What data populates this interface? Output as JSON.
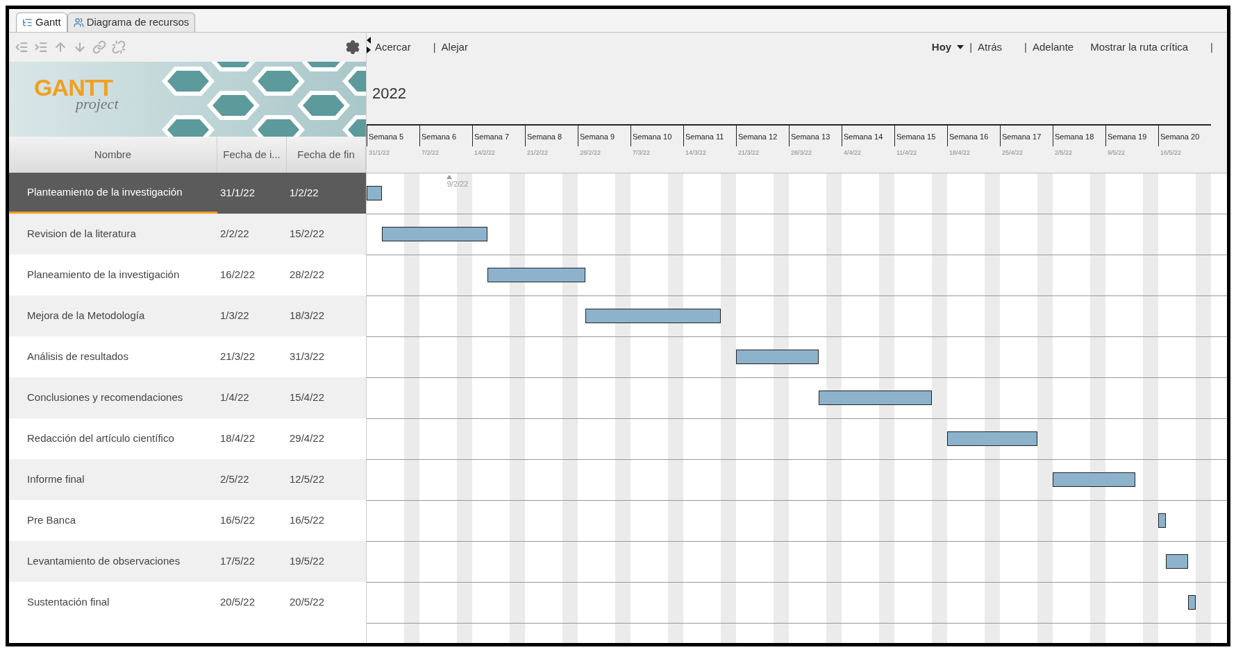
{
  "tabs": [
    {
      "label": "Gantt",
      "kind": "gantt",
      "selected": true
    },
    {
      "label": "Diagrama de recursos",
      "kind": "resources",
      "selected": false
    }
  ],
  "task_toolbar": {
    "tools": [
      {
        "kind": "outdent",
        "disabled": true
      },
      {
        "kind": "indent",
        "disabled": true
      },
      {
        "kind": "up",
        "disabled": true
      },
      {
        "kind": "down",
        "disabled": true
      },
      {
        "kind": "link",
        "disabled": true
      },
      {
        "kind": "unlink",
        "disabled": true
      }
    ]
  },
  "logo": {
    "title": "GANTT",
    "subtitle": "project"
  },
  "columns": [
    "Nombre",
    "Fecha de i...",
    "Fecha de fin"
  ],
  "tasks": [
    {
      "name": "Planteamiento de la investigación",
      "start": "31/1/22",
      "end": "1/2/22",
      "selected": true
    },
    {
      "name": "Revision de la literatura",
      "start": "2/2/22",
      "end": "15/2/22",
      "selected": false
    },
    {
      "name": "Planeamiento de la investigación",
      "start": "16/2/22",
      "end": "28/2/22",
      "selected": false
    },
    {
      "name": "Mejora de la Metodología",
      "start": "1/3/22",
      "end": "18/3/22",
      "selected": false
    },
    {
      "name": "Análisis de resultados",
      "start": "21/3/22",
      "end": "31/3/22",
      "selected": false
    },
    {
      "name": "Conclusiones y recomendaciones",
      "start": "1/4/22",
      "end": "15/4/22",
      "selected": false
    },
    {
      "name": "Redacción del artículo científico",
      "start": "18/4/22",
      "end": "29/4/22",
      "selected": false
    },
    {
      "name": "Informe final",
      "start": "2/5/22",
      "end": "12/5/22",
      "selected": false
    },
    {
      "name": "Pre Banca",
      "start": "16/5/22",
      "end": "16/5/22",
      "selected": false
    },
    {
      "name": "Levantamiento de observaciones",
      "start": "17/5/22",
      "end": "19/5/22",
      "selected": false
    },
    {
      "name": "Sustentación final",
      "start": "20/5/22",
      "end": "20/5/22",
      "selected": false
    }
  ],
  "chart_toolbar": {
    "left": [
      {
        "kind": "link",
        "text": "Acercar"
      },
      {
        "kind": "separator",
        "text": "|"
      },
      {
        "kind": "link",
        "text": "Alejar"
      }
    ],
    "right": [
      {
        "kind": "dropdown",
        "text": "Hoy"
      },
      {
        "kind": "separator",
        "text": "|"
      },
      {
        "kind": "link",
        "text": "Atrás"
      },
      {
        "kind": "separator",
        "text": "|"
      },
      {
        "kind": "link",
        "text": "Adelante"
      },
      {
        "kind": "link",
        "text": "Mostrar la ruta crítica"
      },
      {
        "kind": "separator",
        "text": "|"
      }
    ]
  },
  "year": "2022",
  "weeks": [
    {
      "label": "Semana 5",
      "date": "31/1/22"
    },
    {
      "label": "Semana 6",
      "date": "7/2/22"
    },
    {
      "label": "Semana 7",
      "date": "14/2/22"
    },
    {
      "label": "Semana 8",
      "date": "21/2/22"
    },
    {
      "label": "Semana 9",
      "date": "28/2/22"
    },
    {
      "label": "Semana 10",
      "date": "7/3/22"
    },
    {
      "label": "Semana 11",
      "date": "14/3/22"
    },
    {
      "label": "Semana 12",
      "date": "21/3/22"
    },
    {
      "label": "Semana 13",
      "date": "28/3/22"
    },
    {
      "label": "Semana 14",
      "date": "4/4/22"
    },
    {
      "label": "Semana 15",
      "date": "11/4/22"
    },
    {
      "label": "Semana 16",
      "date": "18/4/22"
    },
    {
      "label": "Semana 17",
      "date": "25/4/22"
    },
    {
      "label": "Semana 18",
      "date": "2/5/22"
    },
    {
      "label": "Semana 19",
      "date": "9/5/22"
    },
    {
      "label": "Semana 20",
      "date": "16/5/22"
    }
  ],
  "marker": {
    "date": "9/2/22"
  }
}
